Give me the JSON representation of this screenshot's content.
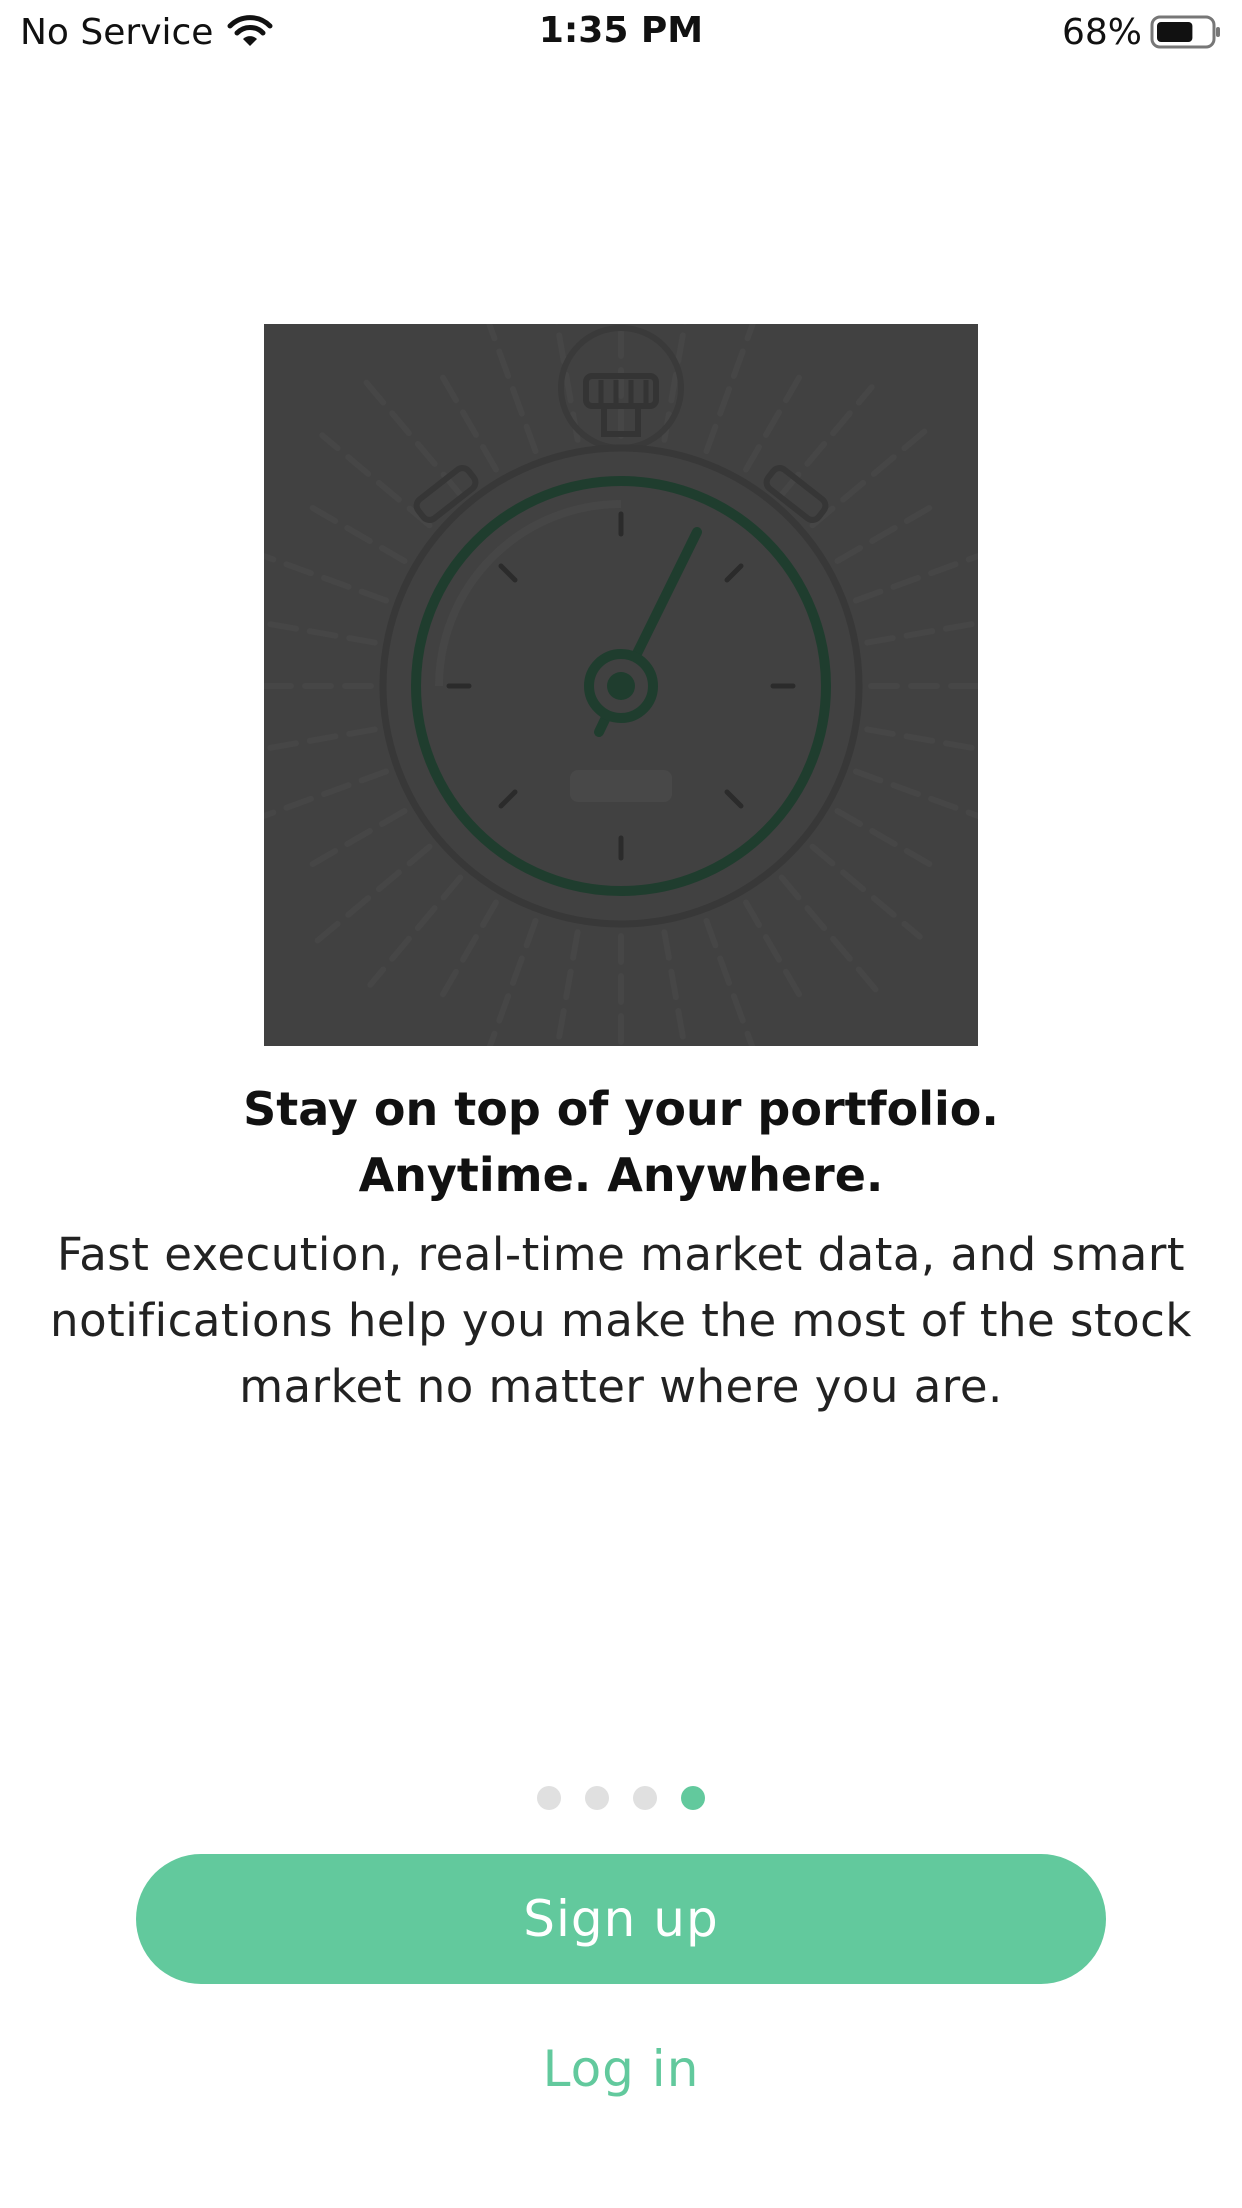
{
  "status_bar": {
    "carrier": "No Service",
    "time": "1:35 PM",
    "battery": "68%",
    "battery_level": 0.68,
    "icons": [
      "wifi-icon",
      "battery-icon"
    ]
  },
  "illustration": {
    "name": "stopwatch-illustration"
  },
  "headline": {
    "line1": "Stay on top of your portfolio.",
    "line2": "Anytime. Anywhere."
  },
  "body": {
    "line1": "Fast execution, real-time market data, and smart",
    "line2": "notifications help you make the most of the stock",
    "line3": "market no matter where you are."
  },
  "pagination": {
    "total": 4,
    "current": 4
  },
  "actions": {
    "signup_label": "Sign up",
    "login_label": "Log in"
  },
  "colors": {
    "accent": "#62c99d",
    "illustration_bg": "#414141",
    "dot_inactive": "#e0e0e0"
  }
}
